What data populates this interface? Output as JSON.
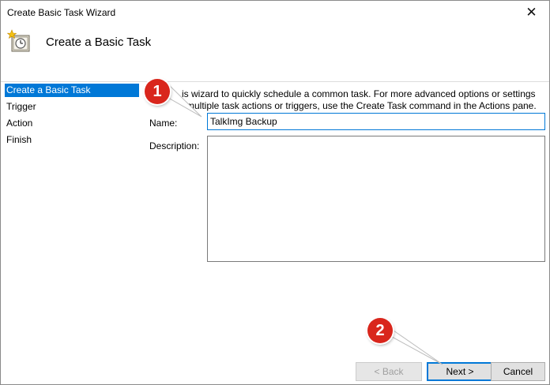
{
  "window": {
    "title": "Create Basic Task Wizard",
    "close_glyph": "✕"
  },
  "header": {
    "title": "Create a Basic Task",
    "icon": "clock-task-icon"
  },
  "sidebar": {
    "items": [
      {
        "label": "Create a Basic Task",
        "selected": true
      },
      {
        "label": "Trigger",
        "selected": false
      },
      {
        "label": "Action",
        "selected": false
      },
      {
        "label": "Finish",
        "selected": false
      }
    ]
  },
  "content": {
    "intro_line1": "is wizard to quickly schedule a common task.  For more advanced options or settings",
    "intro_line2": "multiple task actions or triggers, use the Create Task command in the Actions pane.",
    "name_label": "Name:",
    "name_value": "TalkImg Backup",
    "description_label": "Description:",
    "description_value": ""
  },
  "buttons": {
    "back": "< Back",
    "next": "Next >",
    "cancel": "Cancel"
  },
  "callouts": [
    {
      "number": "1"
    },
    {
      "number": "2"
    }
  ],
  "colors": {
    "accent": "#0078d7",
    "callout": "#d9261c"
  }
}
